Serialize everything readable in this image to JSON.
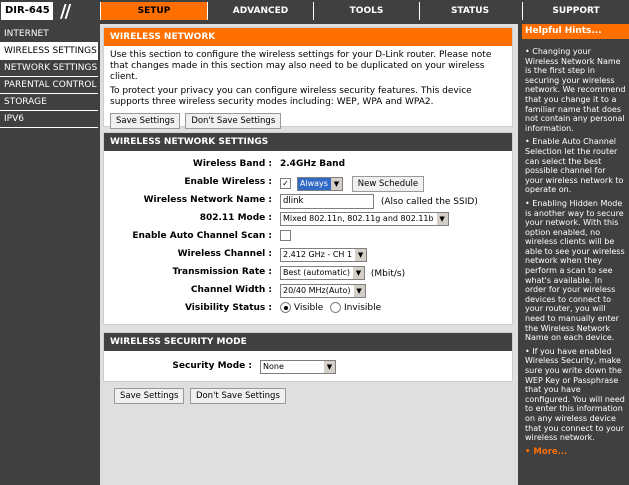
{
  "header": {
    "model": "DIR-645",
    "tabs": [
      "SETUP",
      "ADVANCED",
      "TOOLS",
      "STATUS",
      "SUPPORT"
    ],
    "active_tab": "SETUP"
  },
  "sidebar": {
    "items": [
      "INTERNET",
      "WIRELESS SETTINGS",
      "NETWORK SETTINGS",
      "PARENTAL CONTROL",
      "STORAGE",
      "IPV6"
    ],
    "active": "WIRELESS SETTINGS"
  },
  "intro": {
    "title": "WIRELESS NETWORK",
    "para1": "Use this section to configure the wireless settings for your D-Link router. Please note that changes made in this section may also need to be duplicated on your wireless client.",
    "para2": "To protect your privacy you can configure wireless security features. This device supports three wireless security modes including: WEP, WPA and WPA2.",
    "save_label": "Save Settings",
    "dont_save_label": "Don't Save Settings"
  },
  "wireless": {
    "title": "WIRELESS NETWORK SETTINGS",
    "band_label": "Wireless Band :",
    "band_value": "2.4GHz Band",
    "enable_label": "Enable Wireless :",
    "enable_checked": "✓",
    "schedule_value": "Always",
    "new_schedule_label": "New Schedule",
    "ssid_label": "Wireless Network Name :",
    "ssid_value": "dlink",
    "ssid_note": "(Also called the SSID)",
    "mode_label": "802.11 Mode :",
    "mode_value": "Mixed 802.11n, 802.11g and 802.11b",
    "auto_channel_label": "Enable Auto Channel Scan :",
    "channel_label": "Wireless Channel :",
    "channel_value": "2.412 GHz - CH 1",
    "rate_label": "Transmission Rate :",
    "rate_value": "Best (automatic)",
    "rate_unit": "(Mbit/s)",
    "width_label": "Channel Width :",
    "width_value": "20/40 MHz(Auto)",
    "visibility_label": "Visibility Status :",
    "visible_label": "Visible",
    "invisible_label": "Invisible"
  },
  "security": {
    "title": "WIRELESS SECURITY MODE",
    "mode_label": "Security Mode :",
    "mode_value": "None"
  },
  "bottom": {
    "save_label": "Save Settings",
    "dont_save_label": "Don't Save Settings"
  },
  "hints": {
    "title": "Helpful Hints...",
    "items": [
      "Changing your Wireless Network Name is the first step in securing your wireless network. We recommend that you change it to a familiar name that does not contain any personal information.",
      "Enable Auto Channel Selection let the router can select the best possible channel for your wireless network to operate on.",
      "Enabling Hidden Mode is another way to secure your network. With this option enabled, no wireless clients will be able to see your wireless network when they perform a scan to see what's available. In order for your wireless devices to connect to your router, you will need to manually enter the Wireless Network Name on each device.",
      "If you have enabled Wireless Security, make sure you write down the WEP Key or Passphrase that you have configured. You will need to enter this information on any wireless device that you connect to your wireless network."
    ],
    "more": "More..."
  },
  "colors": {
    "accent": "#ff6f00",
    "dark": "#404040",
    "panel_bg": "#dfdfdf"
  }
}
